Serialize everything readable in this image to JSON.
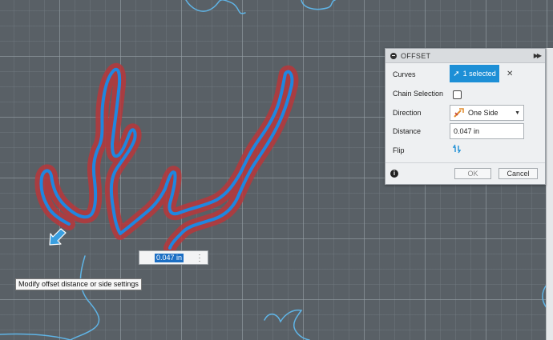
{
  "dialog": {
    "title": "OFFSET",
    "curves": {
      "label": "Curves",
      "button_label": "1 selected"
    },
    "chain_selection": {
      "label": "Chain Selection",
      "checked": false
    },
    "direction": {
      "label": "Direction",
      "value": "One Side"
    },
    "distance": {
      "label": "Distance",
      "value": "0.047 in"
    },
    "flip": {
      "label": "Flip"
    },
    "ok_label": "OK",
    "cancel_label": "Cancel"
  },
  "inline_input": {
    "value": "0.047 in"
  },
  "tooltip": {
    "text": "Modify offset distance or side settings"
  },
  "colors": {
    "canvas": "#596066",
    "selected_curve": "#1f87e0",
    "offset_preview": "#c0383c",
    "sketch_curve": "#5fb4e6",
    "accent": "#1d8fd6"
  },
  "icons": [
    "collapse-icon",
    "expand-icon",
    "cursor-icon",
    "clear-icon",
    "direction-icon",
    "chevron-down-icon",
    "flip-icon",
    "info-icon",
    "drag-arrow-icon",
    "more-options-icon"
  ]
}
